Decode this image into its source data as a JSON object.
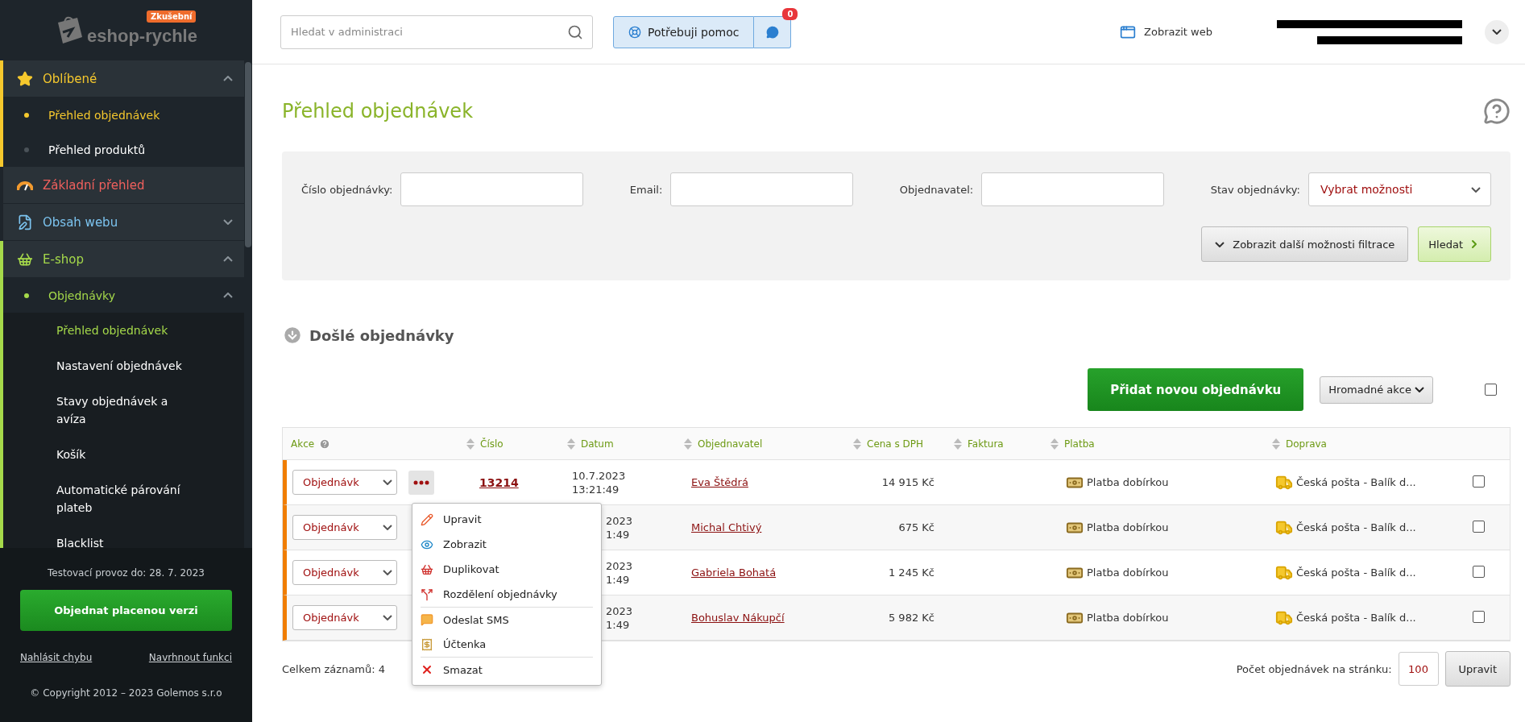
{
  "sidebar": {
    "logo": {
      "name": "eshop-rychle",
      "badge": "Zkušební"
    },
    "groups": [
      {
        "label": "Oblíbené",
        "color": "#f5c82d",
        "kind": "folder",
        "expanded": true,
        "children": [
          {
            "label": "Přehled objednávek",
            "selected": true
          },
          {
            "label": "Přehled produktů",
            "selected": false
          }
        ]
      },
      {
        "label": "Základní přehled",
        "color": "#f0605d",
        "kind": "link"
      },
      {
        "label": "Obsah webu",
        "color": "#7cc4f0",
        "kind": "folder",
        "expanded": false
      },
      {
        "label": "E-shop",
        "color": "#a5d94a",
        "kind": "folder",
        "expanded": true,
        "children": [
          {
            "label": "Objednávky",
            "selected": true,
            "expanded": true,
            "children": [
              {
                "label": "Přehled objednávek",
                "selected": true
              },
              {
                "label": "Nastavení objednávek",
                "selected": false
              },
              {
                "label": "Stavy objednávek a avíza",
                "selected": false
              },
              {
                "label": "Košík",
                "selected": false
              },
              {
                "label": "Automatické párování plateb",
                "selected": false
              },
              {
                "label": "Blacklist",
                "selected": false
              }
            ]
          }
        ]
      }
    ],
    "footer": {
      "trial": "Testovací provoz do: 28. 7. 2023",
      "order_button": "Objednat placenou verzi",
      "links": [
        "Nahlásit chybu",
        "Navrhnout funkci"
      ],
      "copyright": "© Copyright 2012 – 2023 Golemos s.r.o"
    }
  },
  "header": {
    "search": {
      "placeholder": "Hledat v administraci"
    },
    "help_button": "Potřebuji pomoc",
    "chat_badge": "0",
    "view_site": "Zobrazit web"
  },
  "page": {
    "title": "Přehled objednávek",
    "filter": {
      "fields": [
        {
          "label": "Číslo objednávky:",
          "kind": "input"
        },
        {
          "label": "Email:",
          "kind": "input"
        },
        {
          "label": "Objednavatel:",
          "kind": "input"
        },
        {
          "label": "Stav objednávky:",
          "kind": "select",
          "value": "Vybrat možnosti"
        }
      ],
      "more_button": "Zobrazit další možnosti filtrace",
      "search_button": "Hledat"
    },
    "section_title": "Došlé objednávky",
    "add_button": "Přidat novou objednávku",
    "bulk_button": "Hromadné akce",
    "select_all": {
      "checked": false
    },
    "table": {
      "columns": [
        {
          "label": "Akce",
          "sortable": false,
          "help": true
        },
        {
          "label": "Číslo",
          "sortable": true,
          "help": false
        },
        {
          "label": "Datum",
          "sortable": true,
          "help": false
        },
        {
          "label": "Objednavatel",
          "sortable": true,
          "help": false
        },
        {
          "label": "Cena s DPH",
          "sortable": true,
          "help": false
        },
        {
          "label": "Faktura",
          "sortable": true,
          "help": false
        },
        {
          "label": "Platba",
          "sortable": true,
          "help": false
        },
        {
          "label": "Doprava",
          "sortable": true,
          "help": false
        }
      ],
      "rows": [
        {
          "action": "Objednávk",
          "menu_open": true,
          "number": "13214",
          "date": [
            "10.7.2023",
            "13:21:49"
          ],
          "customer": "Eva Štědrá",
          "price": "14 915 Kč",
          "payment": "Platba dobírkou",
          "shipping": "Česká pošta - Balík d...",
          "checked": false
        },
        {
          "action": "Objednávk",
          "menu_open": false,
          "date": [
            "2023",
            "1:49"
          ],
          "customer": "Michal Chtivý",
          "price": "675 Kč",
          "payment": "Platba dobírkou",
          "shipping": "Česká pošta - Balík d...",
          "checked": false
        },
        {
          "action": "Objednávk",
          "menu_open": false,
          "date": [
            "2023",
            "1:49"
          ],
          "customer": "Gabriela Bohatá",
          "price": "1 245 Kč",
          "payment": "Platba dobírkou",
          "shipping": "Česká pošta - Balík d...",
          "checked": false
        },
        {
          "action": "Objednávk",
          "menu_open": false,
          "date": [
            "2023",
            "1:49"
          ],
          "customer": "Bohuslav Nákupčí",
          "price": "5 982 Kč",
          "payment": "Platba dobírkou",
          "shipping": "Česká pošta - Balík d...",
          "checked": false
        }
      ]
    },
    "action_menu": [
      {
        "label": "Upravit",
        "separator_before": false
      },
      {
        "label": "Zobrazit",
        "separator_before": false
      },
      {
        "label": "Duplikovat",
        "separator_before": false
      },
      {
        "label": "Rozdělení objednávky",
        "separator_before": false
      },
      {
        "label": "Odeslat SMS",
        "separator_before": true
      },
      {
        "label": "Účtenka",
        "separator_before": false
      },
      {
        "label": "Smazat",
        "separator_before": true
      }
    ],
    "total": "Celkem záznamů: 4",
    "per_page_label": "Počet objednávek na stránku:",
    "per_page_value": "100",
    "apply_button": "Upravit"
  }
}
